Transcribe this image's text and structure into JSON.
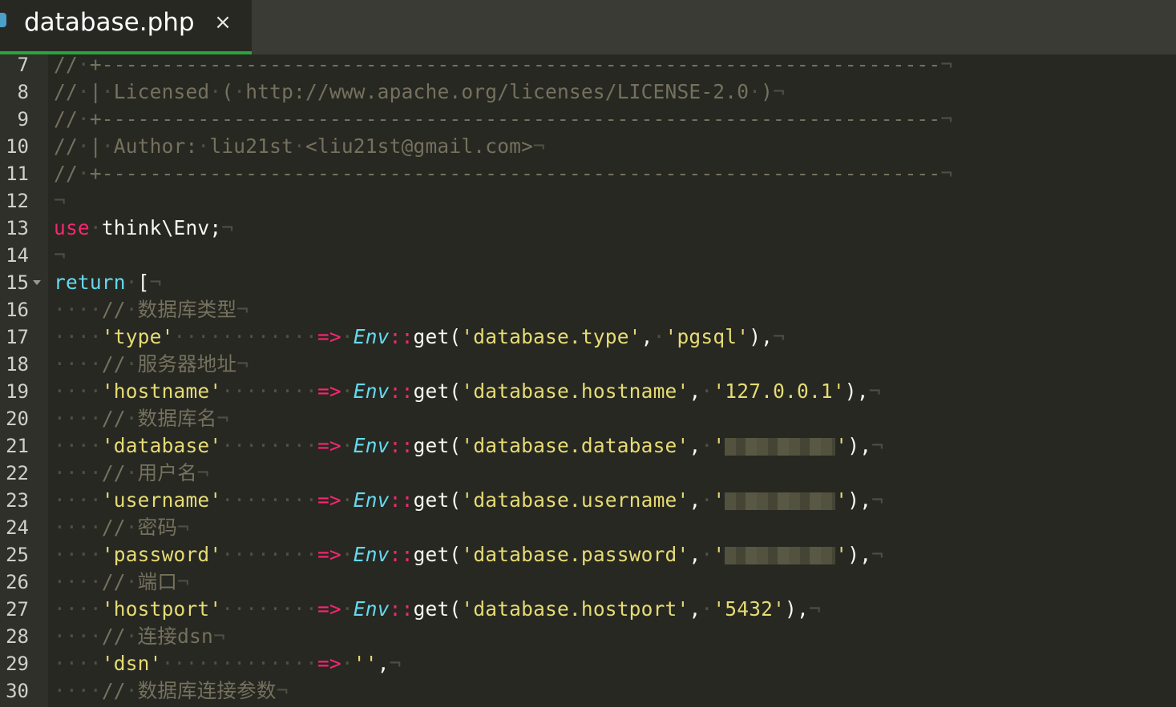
{
  "tab": {
    "title": "database.php",
    "close_icon": "×"
  },
  "lines": [
    {
      "n": "7",
      "c": "// +----------------------------------------------------------------------"
    },
    {
      "n": "8",
      "c": "// | Licensed ( http://www.apache.org/licenses/LICENSE-2.0 )"
    },
    {
      "n": "9",
      "c": "// +----------------------------------------------------------------------"
    },
    {
      "n": "10",
      "c": "// | Author: liu21st <liu21st@gmail.com>"
    },
    {
      "n": "11",
      "c": "// +----------------------------------------------------------------------"
    },
    {
      "n": "12",
      "c": ""
    },
    {
      "n": "13",
      "c": "use think\\Env;"
    },
    {
      "n": "14",
      "c": ""
    },
    {
      "n": "15",
      "c": "return ["
    },
    {
      "n": "16",
      "c": "    // 数据库类型"
    },
    {
      "n": "17",
      "c": "    'type'            => Env::get('database.type', 'pgsql'),"
    },
    {
      "n": "18",
      "c": "    // 服务器地址"
    },
    {
      "n": "19",
      "c": "    'hostname'        => Env::get('database.hostname', '127.0.0.1'),"
    },
    {
      "n": "20",
      "c": "    // 数据库名"
    },
    {
      "n": "21",
      "c": "    'database'        => Env::get('database.database', '[redacted]'),"
    },
    {
      "n": "22",
      "c": "    // 用户名"
    },
    {
      "n": "23",
      "c": "    'username'        => Env::get('database.username', '[redacted]'),"
    },
    {
      "n": "24",
      "c": "    // 密码"
    },
    {
      "n": "25",
      "c": "    'password'        => Env::get('database.password', '[redacted]'),"
    },
    {
      "n": "26",
      "c": "    // 端口"
    },
    {
      "n": "27",
      "c": "    'hostport'        => Env::get('database.hostport', '5432'),"
    },
    {
      "n": "28",
      "c": "    // 连接dsn"
    },
    {
      "n": "29",
      "c": "    'dsn'             => '',"
    },
    {
      "n": "30",
      "c": "    // 数据库连接参数"
    }
  ],
  "text": {
    "dash": "+----------------------------------------------------------------------",
    "licensed": "Licensed",
    "license_url": "http://www.apache.org/licenses/LICENSE-2.0",
    "author_label": "Author:",
    "author_name": "liu21st",
    "author_email": "<liu21st@gmail.com>",
    "use_kw": "use",
    "use_ns": "think\\Env;",
    "return_kw": "return",
    "comment_type": "数据库类型",
    "comment_host": "服务器地址",
    "comment_dbname": "数据库名",
    "comment_user": "用户名",
    "comment_pass": "密码",
    "comment_port": "端口",
    "comment_dsn": "连接dsn",
    "comment_params": "数据库连接参数",
    "key_type": "'type'",
    "key_hostname": "'hostname'",
    "key_database": "'database'",
    "key_username": "'username'",
    "key_password": "'password'",
    "key_hostport": "'hostport'",
    "key_dsn": "'dsn'",
    "env": "Env",
    "get": "get",
    "arg_type": "'database.type'",
    "val_type": "'pgsql'",
    "arg_hostname": "'database.hostname'",
    "val_hostname": "'127.0.0.1'",
    "arg_database": "'database.database'",
    "arg_username": "'username'",
    "arg_username_full": "'database.username'",
    "arg_password": "'database.password'",
    "arg_hostport": "'database.hostport'",
    "val_hostport": "'5432'",
    "val_dsn": "''"
  }
}
